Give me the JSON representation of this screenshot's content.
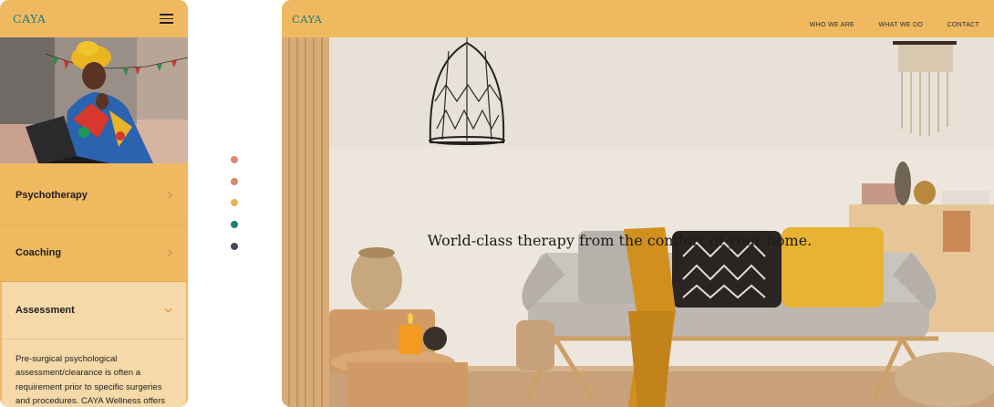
{
  "mobile": {
    "logo": "CAYA",
    "menu_icon": "hamburger-icon",
    "accordion": [
      {
        "label": "Psychotherapy",
        "state": "collapsed"
      },
      {
        "label": "Coaching",
        "state": "collapsed"
      },
      {
        "label": "Assessment",
        "state": "expanded"
      }
    ],
    "assessment_text": "Pre-surgical psychological assessment/clearance is often a requirement prior to specific surgeries and procedures. CAYA Wellness offers"
  },
  "dots": {
    "colors": [
      "#d98a6e",
      "#d98a6e",
      "#e8b45a",
      "#1c7d7a",
      "#4b4566"
    ]
  },
  "desktop": {
    "logo": "CAYA",
    "nav": [
      "WHO WE ARE",
      "WHAT WE DO",
      "CONTACT"
    ],
    "hero_title": "World-class therapy from the comfort of your home."
  },
  "colors": {
    "accent": "#f0b960",
    "accent_light": "#f6d9a9",
    "brand_teal": "#1c7d7a"
  }
}
